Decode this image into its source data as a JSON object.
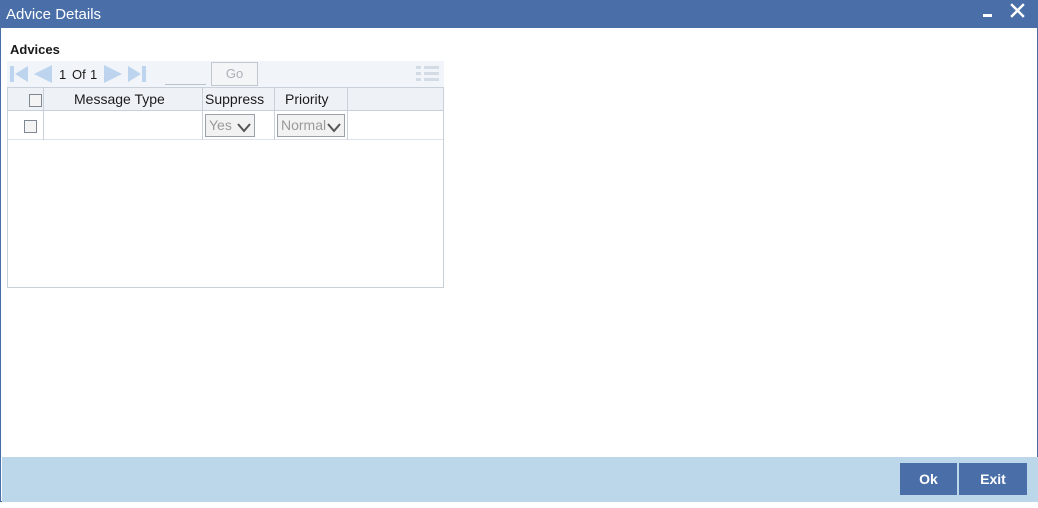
{
  "window": {
    "title": "Advice Details",
    "minimize_icon": "minimize-icon",
    "close_icon": "close-icon"
  },
  "advices": {
    "section_title": "Advices",
    "pagination": {
      "current_page": "1",
      "of_label": "Of",
      "total_pages": "1",
      "go_label": "Go",
      "page_input_value": ""
    },
    "columns": [
      "Message Type",
      "Suppress",
      "Priority"
    ],
    "rows": [
      {
        "message_type": "",
        "suppress": "Yes",
        "priority": "Normal",
        "checked": false
      }
    ]
  },
  "footer": {
    "ok_label": "Ok",
    "exit_label": "Exit"
  },
  "colors": {
    "titlebar": "#4a6fa8",
    "footer": "#bcd6ea",
    "button": "#4a6fa8",
    "nav_icon_disabled": "#bcd4ee"
  }
}
